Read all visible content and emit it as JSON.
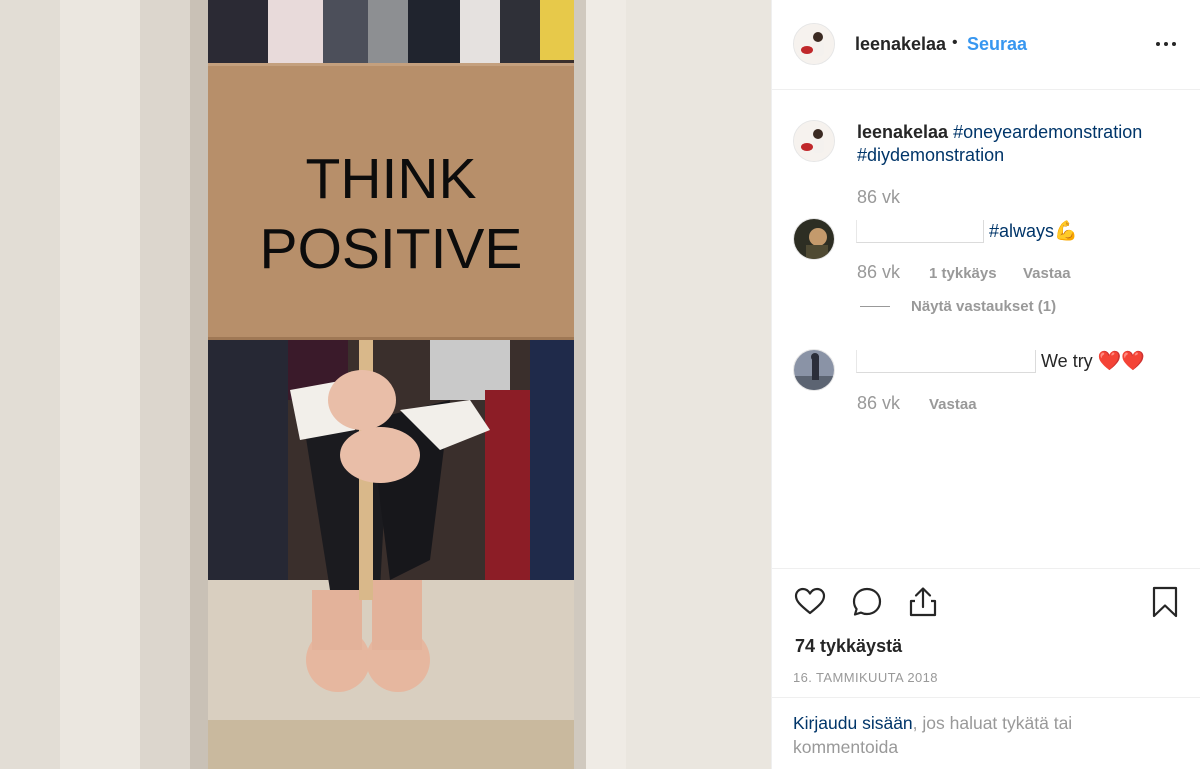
{
  "post": {
    "image": {
      "sign_line1": "THINK",
      "sign_line2": "POSITIVE"
    },
    "header": {
      "username": "leenakelaa",
      "separator": "•",
      "follow_label": "Seuraa",
      "more_icon": "more-horizontal-icon"
    },
    "caption": {
      "username": "leenakelaa",
      "tags": [
        "#oneyeardemonstration",
        "#diydemonstration"
      ],
      "time": "86 vk"
    },
    "comments": [
      {
        "text": "#always",
        "emoji": "💪",
        "time": "86 vk",
        "likes": "1 tykkäys",
        "reply_label": "Vastaa",
        "view_replies": "Näytä vastaukset (1)"
      },
      {
        "text": "We try",
        "emoji": "❤️❤️",
        "time": "86 vk",
        "reply_label": "Vastaa"
      }
    ],
    "actions": {
      "like_icon": "heart-icon",
      "comment_icon": "comment-icon",
      "share_icon": "share-icon",
      "save_icon": "bookmark-icon"
    },
    "likes_count": "74 tykkäystä",
    "date": "16. TAMMIKUUTA 2018",
    "login_prompt": {
      "link": "Kirjaudu sisään",
      "rest": ", jos haluat tykätä tai kommentoida"
    }
  },
  "colors": {
    "link_blue": "#3897f0",
    "tag_blue": "#003569",
    "secondary_gray": "#999999",
    "text": "#262626",
    "cardboard": "#b78f6a"
  }
}
